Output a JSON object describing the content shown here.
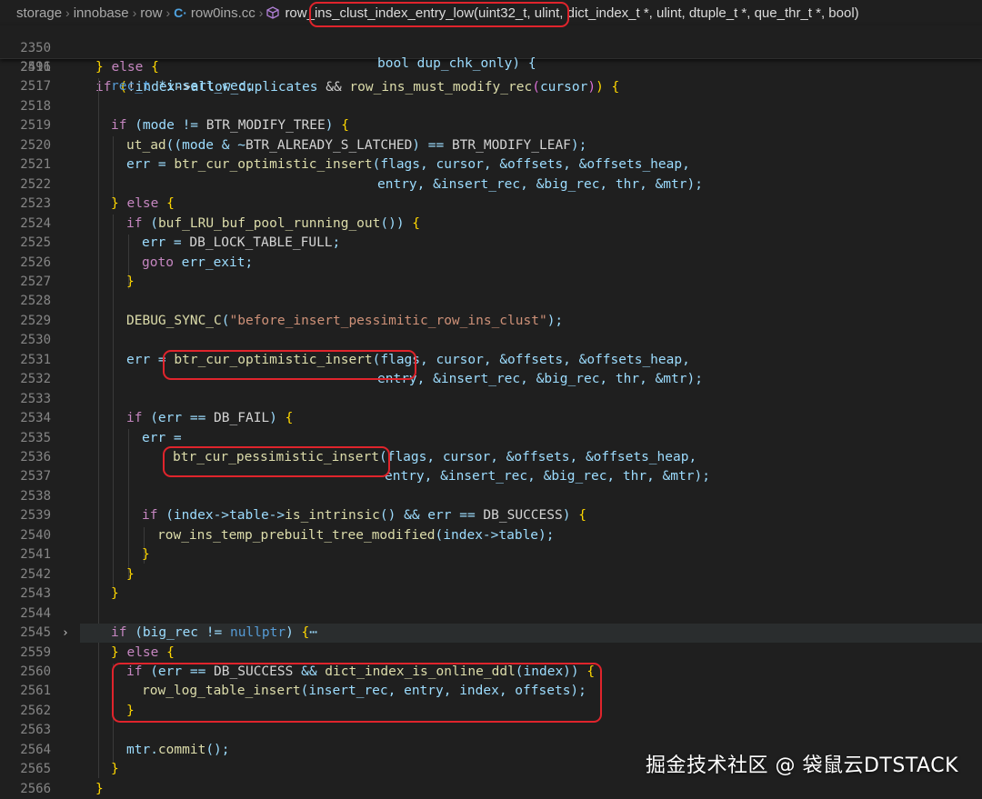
{
  "breadcrumb": {
    "items": [
      "storage",
      "innobase",
      "row",
      "row0ins.cc"
    ],
    "function_signature": "row_ins_clust_index_entry_low(uint32_t, ulint, dict_index_t *, ulint, dtuple_t *, que_thr_t *, bool)"
  },
  "sticky_lines": [
    {
      "num": "2350",
      "text": "bool dup_chk_only) {"
    },
    {
      "num": "2491",
      "text": "if (!index->allow_duplicates && row_ins_must_modify_rec(cursor)) {"
    }
  ],
  "lines": [
    {
      "num": "2516",
      "text": "} else {"
    },
    {
      "num": "2517",
      "text": "rec_t *insert_rec;"
    },
    {
      "num": "2518",
      "text": ""
    },
    {
      "num": "2519",
      "text": "if (mode != BTR_MODIFY_TREE) {"
    },
    {
      "num": "2520",
      "text": "ut_ad((mode & ~BTR_ALREADY_S_LATCHED) == BTR_MODIFY_LEAF);"
    },
    {
      "num": "2521",
      "text": "err = btr_cur_optimistic_insert(flags, cursor, &offsets, &offsets_heap,"
    },
    {
      "num": "2522",
      "text": "entry, &insert_rec, &big_rec, thr, &mtr);"
    },
    {
      "num": "2523",
      "text": "} else {"
    },
    {
      "num": "2524",
      "text": "if (buf_LRU_buf_pool_running_out()) {"
    },
    {
      "num": "2525",
      "text": "err = DB_LOCK_TABLE_FULL;"
    },
    {
      "num": "2526",
      "text": "goto err_exit;"
    },
    {
      "num": "2527",
      "text": "}"
    },
    {
      "num": "2528",
      "text": ""
    },
    {
      "num": "2529",
      "text": "DEBUG_SYNC_C(\"before_insert_pessimitic_row_ins_clust\");"
    },
    {
      "num": "2530",
      "text": ""
    },
    {
      "num": "2531",
      "text": "err = btr_cur_optimistic_insert(flags, cursor, &offsets, &offsets_heap,"
    },
    {
      "num": "2532",
      "text": "entry, &insert_rec, &big_rec, thr, &mtr);"
    },
    {
      "num": "2533",
      "text": ""
    },
    {
      "num": "2534",
      "text": "if (err == DB_FAIL) {"
    },
    {
      "num": "2535",
      "text": "err ="
    },
    {
      "num": "2536",
      "text": "btr_cur_pessimistic_insert(flags, cursor, &offsets, &offsets_heap,"
    },
    {
      "num": "2537",
      "text": "entry, &insert_rec, &big_rec, thr, &mtr);"
    },
    {
      "num": "2538",
      "text": ""
    },
    {
      "num": "2539",
      "text": "if (index->table->is_intrinsic() && err == DB_SUCCESS) {"
    },
    {
      "num": "2540",
      "text": "row_ins_temp_prebuilt_tree_modified(index->table);"
    },
    {
      "num": "2541",
      "text": "}"
    },
    {
      "num": "2542",
      "text": "}"
    },
    {
      "num": "2543",
      "text": "}"
    },
    {
      "num": "2544",
      "text": ""
    },
    {
      "num": "2545",
      "text": "if (big_rec != nullptr) {⋯"
    },
    {
      "num": "2559",
      "text": "} else {"
    },
    {
      "num": "2560",
      "text": "if (err == DB_SUCCESS && dict_index_is_online_ddl(index)) {"
    },
    {
      "num": "2561",
      "text": "row_log_table_insert(insert_rec, entry, index, offsets);"
    },
    {
      "num": "2562",
      "text": "}"
    },
    {
      "num": "2563",
      "text": ""
    },
    {
      "num": "2564",
      "text": "mtr.commit();"
    },
    {
      "num": "2565",
      "text": "}"
    },
    {
      "num": "2566",
      "text": "}"
    }
  ],
  "watermark": "掘金技术社区 @ 袋鼠云DTSTACK",
  "colors": {
    "background": "#1f1f1f",
    "annotation_red": "#e0242c",
    "line_number": "#858585"
  }
}
